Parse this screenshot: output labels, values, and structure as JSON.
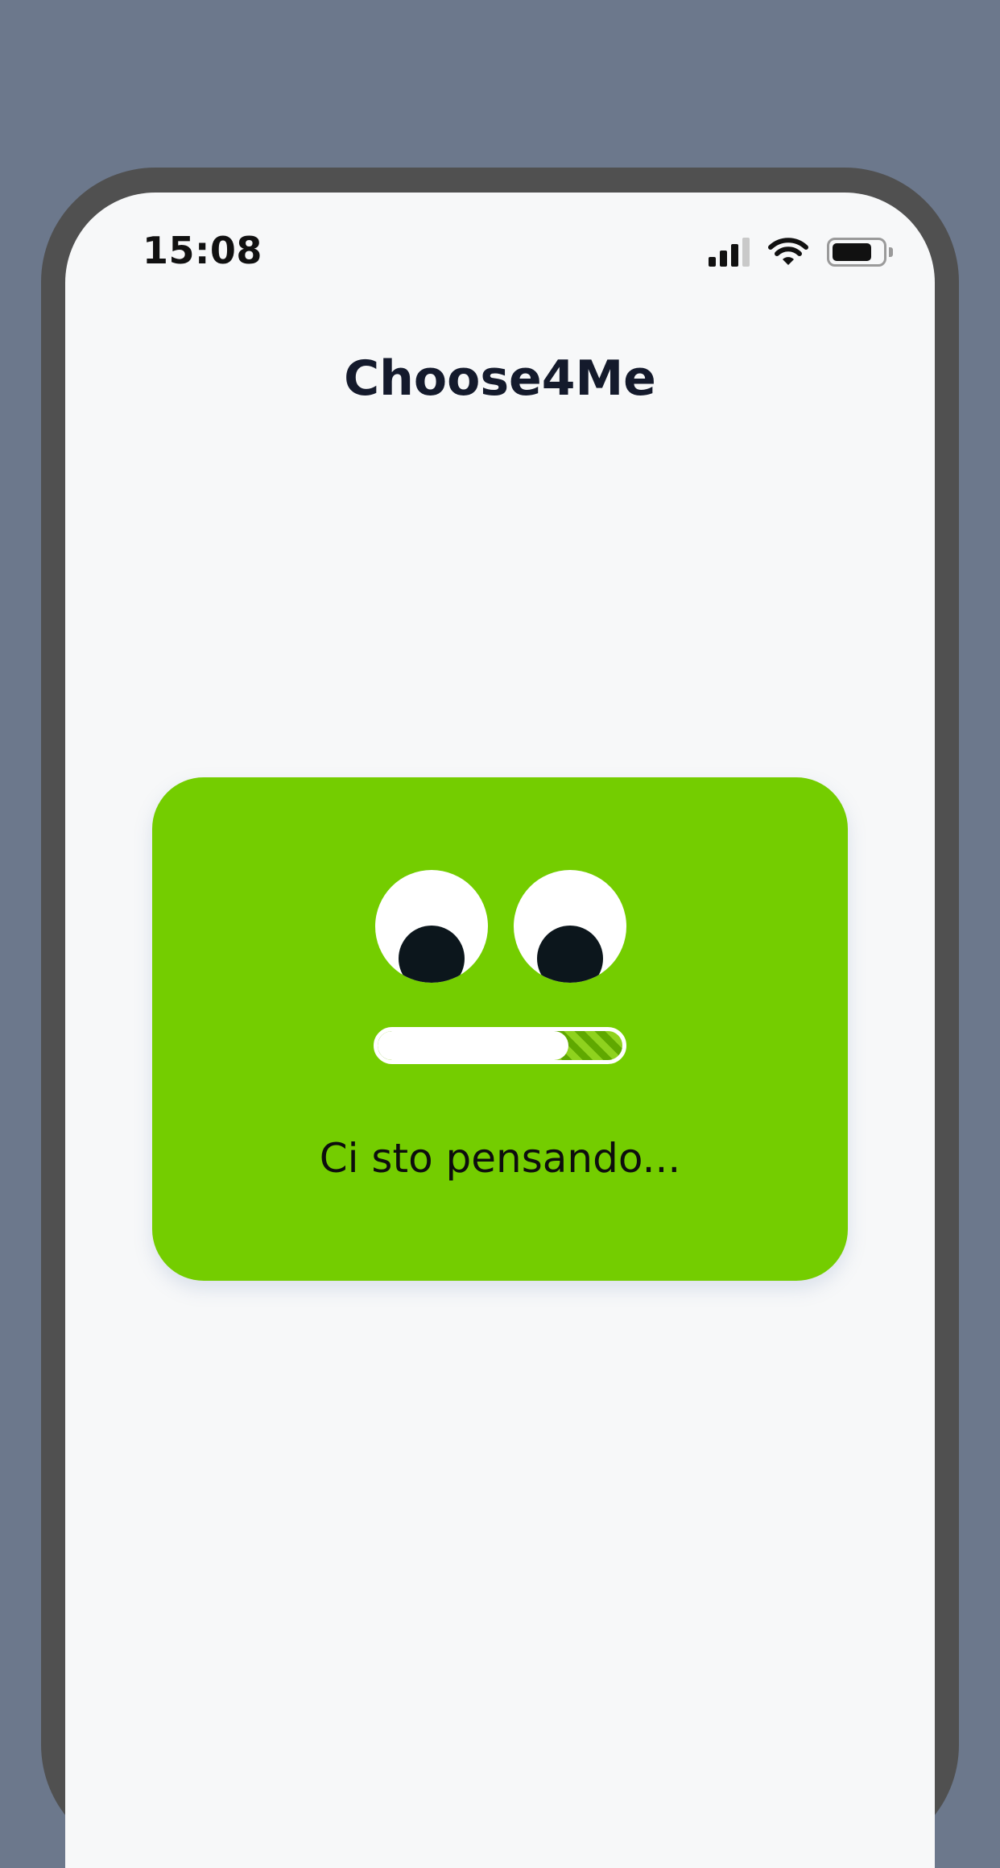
{
  "status_bar": {
    "time": "15:08",
    "icons": [
      "signal-icon",
      "wifi-icon",
      "battery-icon"
    ],
    "signal_bars_active": 3,
    "signal_bars_total": 4,
    "battery_level": 0.8
  },
  "header": {
    "title": "Choose4Me"
  },
  "loading_card": {
    "message": "Ci sto pensando...",
    "progress": 0.78,
    "colors": {
      "card": "#74cd00",
      "eye": "#ffffff",
      "pupil": "#0c161c",
      "progress_fill": "#ffffff",
      "progress_stripes": [
        "#5fa800",
        "#8fd21e"
      ]
    }
  },
  "colors": {
    "background": "#6c788c",
    "device_frame": "#505050",
    "screen": "#f7f8f9",
    "title_text": "#141a2c"
  }
}
